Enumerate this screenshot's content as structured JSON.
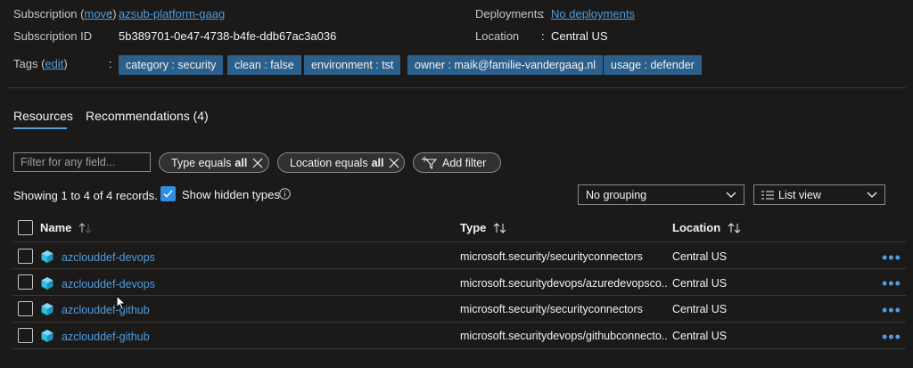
{
  "essentials": {
    "subscription_label": "Subscription",
    "move_label": "move",
    "subscription_name": "azsub-platform-gaag",
    "subscription_id_label": "Subscription ID",
    "subscription_id": "5b389701-0e47-4738-b4fe-ddb67ac3a036",
    "tags_label": "Tags",
    "edit_label": "edit",
    "deployments_label": "Deployments",
    "deployments_value": "No deployments",
    "location_label": "Location",
    "location_value": "Central US"
  },
  "tags": [
    "category : security",
    "clean : false",
    "environment : tst",
    "owner : maik@familie-vandergaag.nl",
    "usage : defender"
  ],
  "tabs": [
    {
      "label": "Resources",
      "selected": true
    },
    {
      "label": "Recommendations (4)",
      "selected": false
    }
  ],
  "filters": {
    "search_placeholder": "Filter for any field...",
    "type_filter_prefix": "Type equals",
    "type_filter_value": "all",
    "location_filter_prefix": "Location equals",
    "location_filter_value": "all",
    "add_filter_label": "Add filter"
  },
  "records_text": "Showing 1 to 4 of 4 records.",
  "show_hidden_types": {
    "label": "Show hidden types",
    "checked": true
  },
  "grouping": {
    "selected": "No grouping"
  },
  "view": {
    "selected": "List view"
  },
  "table": {
    "columns": [
      "Name",
      "Type",
      "Location"
    ],
    "rows": [
      {
        "name": "azclouddef-devops",
        "type": "microsoft.security/securityconnectors",
        "location": "Central US"
      },
      {
        "name": "azclouddef-devops",
        "type": "microsoft.securitydevops/azuredevopsco...",
        "location": "Central US"
      },
      {
        "name": "azclouddef-github",
        "type": "microsoft.security/securityconnectors",
        "location": "Central US"
      },
      {
        "name": "azclouddef-github",
        "type": "microsoft.securitydevops/githubconnecto...",
        "location": "Central US"
      }
    ],
    "row_menu": "•••"
  },
  "colors": {
    "background": "#1b1a19",
    "accent": "#4f9dde",
    "tag_bg": "#2b5f8c",
    "checkbox_checked": "#2f8de4"
  },
  "icons": {
    "resource": "cube-icon",
    "clear_filter": "close-icon",
    "add_filter": "filter-add-icon",
    "info": "info-icon",
    "dropdown": "chevron-down-icon",
    "list_view": "list-icon",
    "sort": "sort-arrows-icon"
  }
}
